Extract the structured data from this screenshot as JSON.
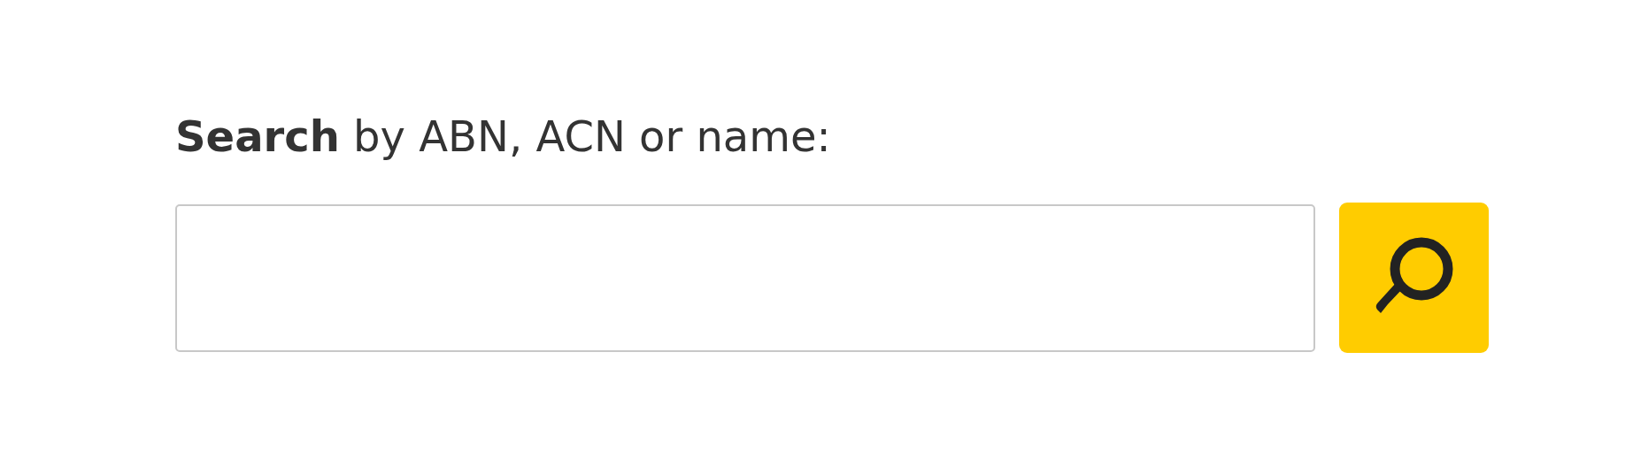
{
  "search": {
    "label": "**Search** by ABN, ACN or name:"
  }
}
